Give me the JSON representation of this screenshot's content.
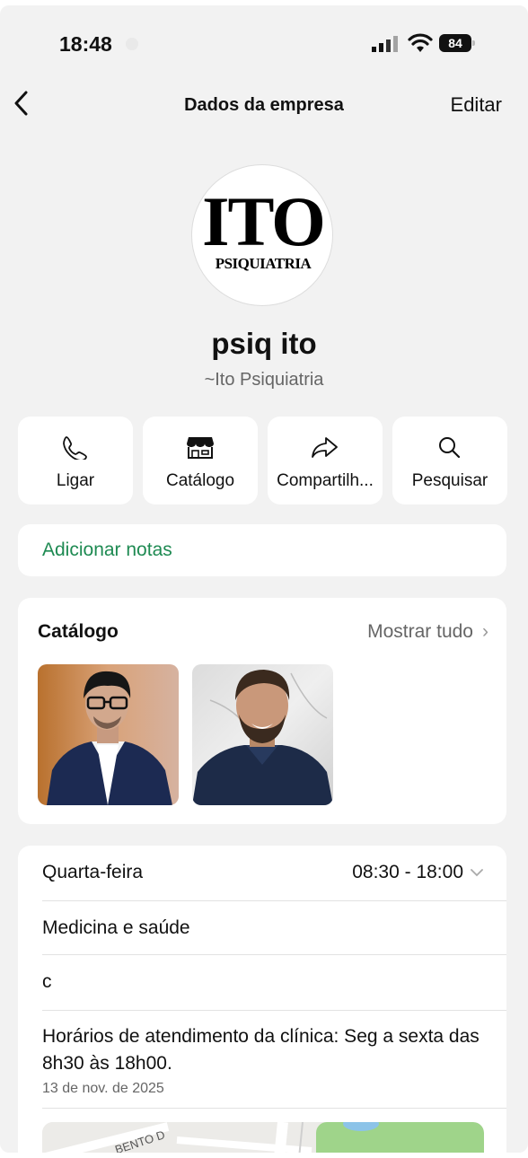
{
  "status_bar": {
    "time": "18:48",
    "battery": "84"
  },
  "nav": {
    "title": "Dados da empresa",
    "edit_label": "Editar"
  },
  "profile": {
    "logo_main": "ITO",
    "logo_sub": "PSIQUIATRIA",
    "name": "psiq ito",
    "subname": "~Ito Psiquiatria"
  },
  "actions": [
    {
      "label": "Ligar",
      "icon": "phone-icon"
    },
    {
      "label": "Catálogo",
      "icon": "storefront-icon"
    },
    {
      "label": "Compartilh...",
      "icon": "share-icon"
    },
    {
      "label": "Pesquisar",
      "icon": "search-icon"
    }
  ],
  "notes": {
    "label": "Adicionar notas"
  },
  "catalog": {
    "title": "Catálogo",
    "show_all": "Mostrar tudo"
  },
  "info": {
    "day": "Quarta-feira",
    "hours": "08:30 - 18:00",
    "category": "Medicina e saúde",
    "extra": "c",
    "description": "Horários de atendimento da clínica: Seg a sexta das 8h30 às 18h00.",
    "date": "13 de nov. de 2025",
    "map_street": "BENTO D"
  },
  "colors": {
    "accent_green": "#1e8a52",
    "background": "#f2f2f2",
    "card": "#ffffff"
  }
}
